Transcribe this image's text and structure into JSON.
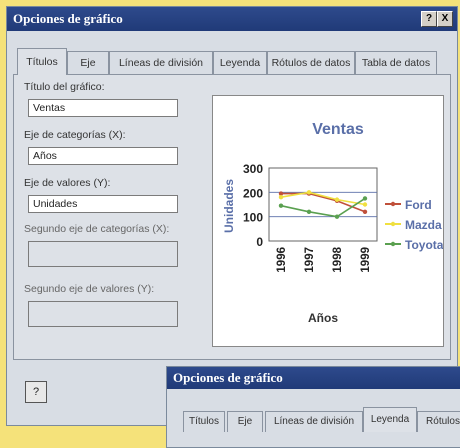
{
  "dialog": {
    "title": "Opciones de gráfico",
    "help_btn": "?",
    "close_btn": "X"
  },
  "tabs": [
    "Títulos",
    "Eje",
    "Líneas de división",
    "Leyenda",
    "Rótulos de datos",
    "Tabla de datos"
  ],
  "form": {
    "chart_title_label": "Título del gráfico:",
    "chart_title_value": "Ventas",
    "category_axis_label": "Eje de categorías (X):",
    "category_axis_value": "Años",
    "value_axis_label": "Eje de valores (Y):",
    "value_axis_value": "Unidades",
    "second_category_label": "Segundo eje de categorías (X):",
    "second_value_label": "Segundo eje de valores (Y):"
  },
  "help_icon": "?",
  "dialog2": {
    "title": "Opciones de gráfico",
    "tabs": [
      "Títulos",
      "Eje",
      "Líneas de división",
      "Leyenda",
      "Rótulos"
    ]
  },
  "colors": {
    "ford": "#c0503a",
    "mazda": "#f0e040",
    "toyota": "#5aa050",
    "title": "#5a6fa8"
  },
  "chart_data": {
    "type": "line",
    "title": "Ventas",
    "xlabel": "Años",
    "ylabel": "Unidades",
    "categories": [
      "1996",
      "1997",
      "1998",
      "1999"
    ],
    "ylim": [
      0,
      300
    ],
    "yticks": [
      "0",
      "100",
      "200",
      "300"
    ],
    "series": [
      {
        "name": "Ford",
        "values": [
          195,
          195,
          165,
          120
        ]
      },
      {
        "name": "Mazda",
        "values": [
          180,
          200,
          170,
          150
        ]
      },
      {
        "name": "Toyota",
        "values": [
          145,
          120,
          100,
          175
        ]
      }
    ],
    "legend": "right"
  }
}
